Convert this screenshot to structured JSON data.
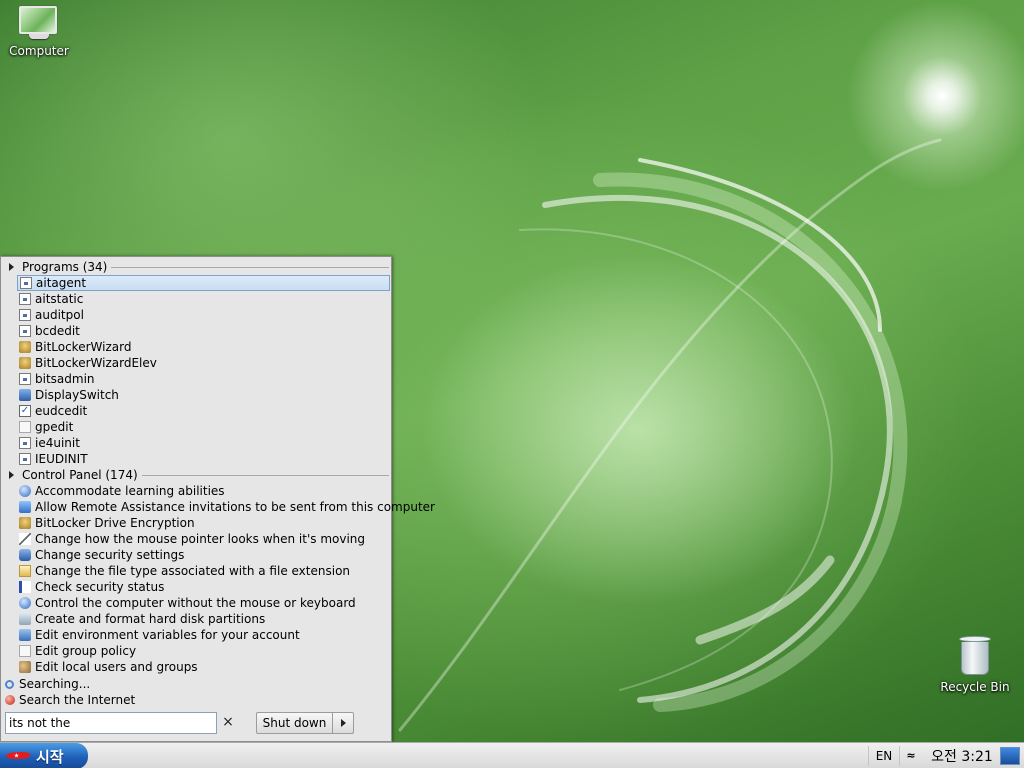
{
  "desktop": {
    "icons": [
      {
        "label": "Computer",
        "icon": "computer-icon"
      },
      {
        "label": "Recycle Bin",
        "icon": "recycle-bin-icon"
      }
    ]
  },
  "start_menu": {
    "programs": {
      "header": "Programs (34)",
      "items": [
        {
          "label": "aitagent",
          "icon": "exe-icon",
          "selected": true
        },
        {
          "label": "aitstatic",
          "icon": "exe-icon"
        },
        {
          "label": "auditpol",
          "icon": "exe-icon"
        },
        {
          "label": "bcdedit",
          "icon": "exe-icon"
        },
        {
          "label": "BitLockerWizard",
          "icon": "bitlocker-icon"
        },
        {
          "label": "BitLockerWizardElev",
          "icon": "bitlocker-icon"
        },
        {
          "label": "bitsadmin",
          "icon": "exe-icon"
        },
        {
          "label": "DisplaySwitch",
          "icon": "display-icon"
        },
        {
          "label": "eudcedit",
          "icon": "eudc-icon"
        },
        {
          "label": "gpedit",
          "icon": "document-icon"
        },
        {
          "label": "ie4uinit",
          "icon": "exe-icon"
        },
        {
          "label": "IEUDINIT",
          "icon": "exe-icon"
        }
      ]
    },
    "control_panel": {
      "header": "Control Panel (174)",
      "items": [
        {
          "label": "Accommodate learning abilities",
          "icon": "ease-of-access-icon"
        },
        {
          "label": "Allow Remote Assistance invitations to be sent from this computer",
          "icon": "remote-assistance-icon"
        },
        {
          "label": "BitLocker Drive Encryption",
          "icon": "bitlocker-icon"
        },
        {
          "label": "Change how the mouse pointer looks when it's moving",
          "icon": "mouse-icon"
        },
        {
          "label": "Change security settings",
          "icon": "security-icon"
        },
        {
          "label": "Change the file type associated with a file extension",
          "icon": "file-type-icon"
        },
        {
          "label": "Check security status",
          "icon": "flag-icon"
        },
        {
          "label": "Control the computer without the mouse or keyboard",
          "icon": "ease-of-access-icon"
        },
        {
          "label": "Create and format hard disk partitions",
          "icon": "disk-icon"
        },
        {
          "label": "Edit environment variables for your account",
          "icon": "environment-icon"
        },
        {
          "label": "Edit group policy",
          "icon": "document-icon"
        },
        {
          "label": "Edit local users and groups",
          "icon": "users-icon"
        }
      ]
    },
    "searching_label": "Searching...",
    "search_internet_label": "Search the Internet",
    "search_value": "its not the",
    "clear_symbol": "×",
    "shutdown_label": "Shut down"
  },
  "taskbar": {
    "start_label": "시작",
    "language": "EN",
    "chevron": "≈",
    "clock": "오전 3:21"
  }
}
